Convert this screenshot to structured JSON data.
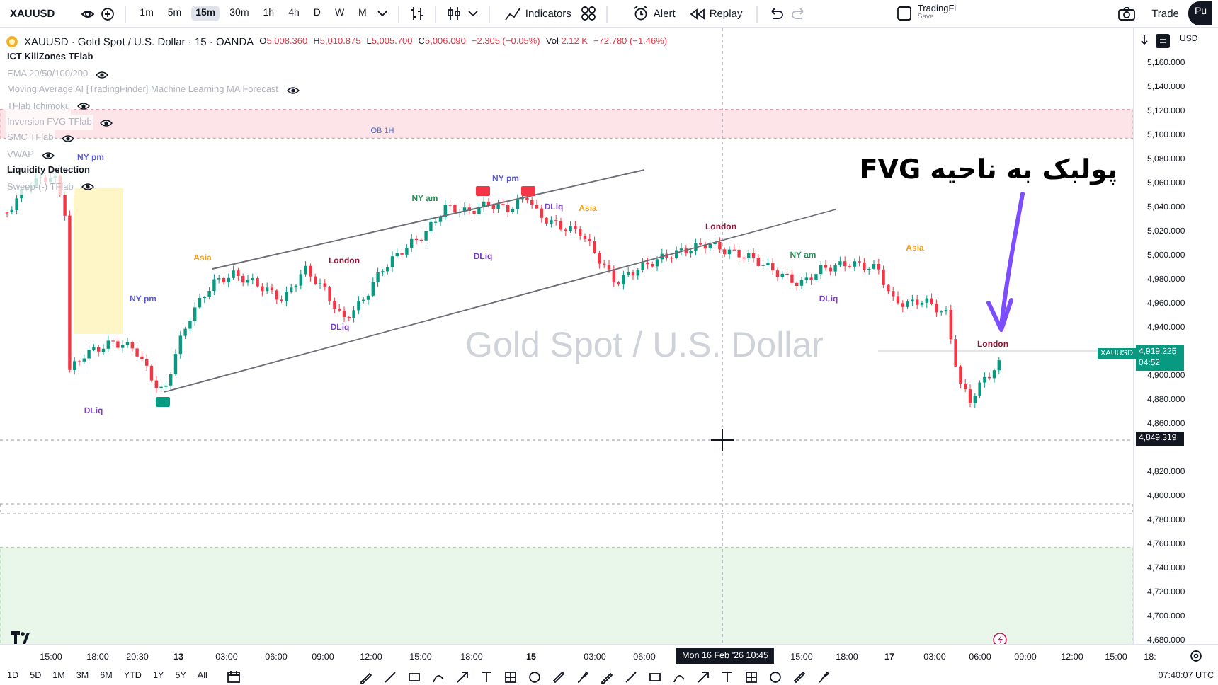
{
  "toolbar": {
    "symbol": "XAUUSD",
    "intervals": [
      {
        "label": "1m",
        "selected": false
      },
      {
        "label": "5m",
        "selected": false
      },
      {
        "label": "15m",
        "selected": true
      },
      {
        "label": "30m",
        "selected": false
      },
      {
        "label": "1h",
        "selected": false
      },
      {
        "label": "4h",
        "selected": false
      },
      {
        "label": "D",
        "selected": false
      },
      {
        "label": "W",
        "selected": false
      },
      {
        "label": "M",
        "selected": false
      }
    ],
    "indicators_button": "Indicators",
    "alert_button": "Alert",
    "replay_button": "Replay",
    "layout_name": "TradingFi",
    "layout_status": "Save",
    "trade_button": "Trade",
    "publish_button": "Pu"
  },
  "legend": {
    "title": "XAUUSD · Gold Spot / U.S. Dollar · 15 · OANDA",
    "ohlc": [
      {
        "label": "O",
        "value": "5,008.360"
      },
      {
        "label": "H",
        "value": "5,010.875"
      },
      {
        "label": "L",
        "value": "5,005.700"
      },
      {
        "label": "C",
        "value": "5,006.090"
      }
    ],
    "change": "−2.305 (−0.05%)",
    "volume_label": "Vol",
    "volume": "2.12 K",
    "volume_change": "−72.780 (−1.46%)",
    "indicators": [
      {
        "name": "ICT KillZones TFlab",
        "hidden": false
      },
      {
        "name": "EMA 20/50/100/200",
        "hidden": true
      },
      {
        "name": "Moving Average AI [TradingFinder] Machine Learning MA Forecast",
        "hidden": true
      },
      {
        "name": "TFlab Ichimoku",
        "hidden": true
      },
      {
        "name": "Inversion FVG TFlab",
        "hidden": true
      },
      {
        "name": "SMC TFlab",
        "hidden": true
      },
      {
        "name": "VWAP",
        "hidden": true
      },
      {
        "name": "Liquidity Detection",
        "hidden": false
      },
      {
        "name": "Sweep-(-) TFlab",
        "hidden": true
      }
    ]
  },
  "chart": {
    "watermark": "Gold Spot / U.S. Dollar",
    "zone_label": "OB 1H",
    "session_labels": [
      {
        "text": "NY pm",
        "color": "#5b5bd6"
      },
      {
        "text": "Asia",
        "color": "#f0a020"
      },
      {
        "text": "NY pm",
        "color": "#5b5bd6"
      },
      {
        "text": "London",
        "color": "#8b1a3a"
      },
      {
        "text": "DLiq",
        "color": "#7b3fbf"
      },
      {
        "text": "DLiq",
        "color": "#7b3fbf"
      },
      {
        "text": "NY am",
        "color": "#2e8b57"
      },
      {
        "text": "NY pm",
        "color": "#5b5bd6"
      },
      {
        "text": "DLiq",
        "color": "#7b3fbf"
      },
      {
        "text": "DLiq",
        "color": "#7b3fbf"
      },
      {
        "text": "Asia",
        "color": "#f0a020"
      },
      {
        "text": "London",
        "color": "#8b1a3a"
      },
      {
        "text": "NY am",
        "color": "#2e8b57"
      },
      {
        "text": "DLiq",
        "color": "#7b3fbf"
      },
      {
        "text": "Asia",
        "color": "#f0a020"
      },
      {
        "text": "London",
        "color": "#8b1a3a"
      }
    ],
    "annotation": "پولبک به ناحیه FVG"
  },
  "price_axis": {
    "currency": "USD",
    "labels": [
      "5,160.000",
      "5,140.000",
      "5,120.000",
      "5,100.000",
      "5,080.000",
      "5,060.000",
      "5,040.000",
      "5,020.000",
      "5,000.000",
      "4,980.000",
      "4,960.000",
      "4,940.000",
      "4,900.000",
      "4,880.000",
      "4,860.000",
      "4,820.000",
      "4,800.000",
      "4,780.000",
      "4,760.000",
      "4,740.000",
      "4,720.000",
      "4,700.000",
      "4,680.000"
    ],
    "last_symbol": "XAUUSD",
    "last_price": "4,919.225",
    "countdown": "04:52",
    "crosshair_price": "4,849.319"
  },
  "time_axis": {
    "labels": [
      {
        "text": "15:00",
        "kind": "tick"
      },
      {
        "text": "18:00",
        "kind": "tick"
      },
      {
        "text": "20:30",
        "kind": "tick"
      },
      {
        "text": "13",
        "kind": "day"
      },
      {
        "text": "03:00",
        "kind": "tick"
      },
      {
        "text": "06:00",
        "kind": "tick"
      },
      {
        "text": "09:00",
        "kind": "tick"
      },
      {
        "text": "12:00",
        "kind": "tick"
      },
      {
        "text": "15:00",
        "kind": "tick"
      },
      {
        "text": "18:00",
        "kind": "tick"
      },
      {
        "text": "15",
        "kind": "day"
      },
      {
        "text": "03:00",
        "kind": "tick"
      },
      {
        "text": "06:00",
        "kind": "tick"
      },
      {
        "text": "Mon 16 Feb '26   10:45",
        "kind": "crosshair"
      },
      {
        "text": "15:00",
        "kind": "tick"
      },
      {
        "text": "18:00",
        "kind": "tick"
      },
      {
        "text": "17",
        "kind": "day"
      },
      {
        "text": "03:00",
        "kind": "tick"
      },
      {
        "text": "06:00",
        "kind": "tick"
      },
      {
        "text": "09:00",
        "kind": "tick"
      },
      {
        "text": "12:00",
        "kind": "tick"
      },
      {
        "text": "15:00",
        "kind": "tick"
      },
      {
        "text": "18:",
        "kind": "tick"
      }
    ]
  },
  "bottom_bar": {
    "ranges": [
      "1D",
      "5D",
      "1M",
      "3M",
      "6M",
      "YTD",
      "1Y",
      "5Y",
      "All"
    ],
    "clock": "07:40:07 UTC"
  }
}
